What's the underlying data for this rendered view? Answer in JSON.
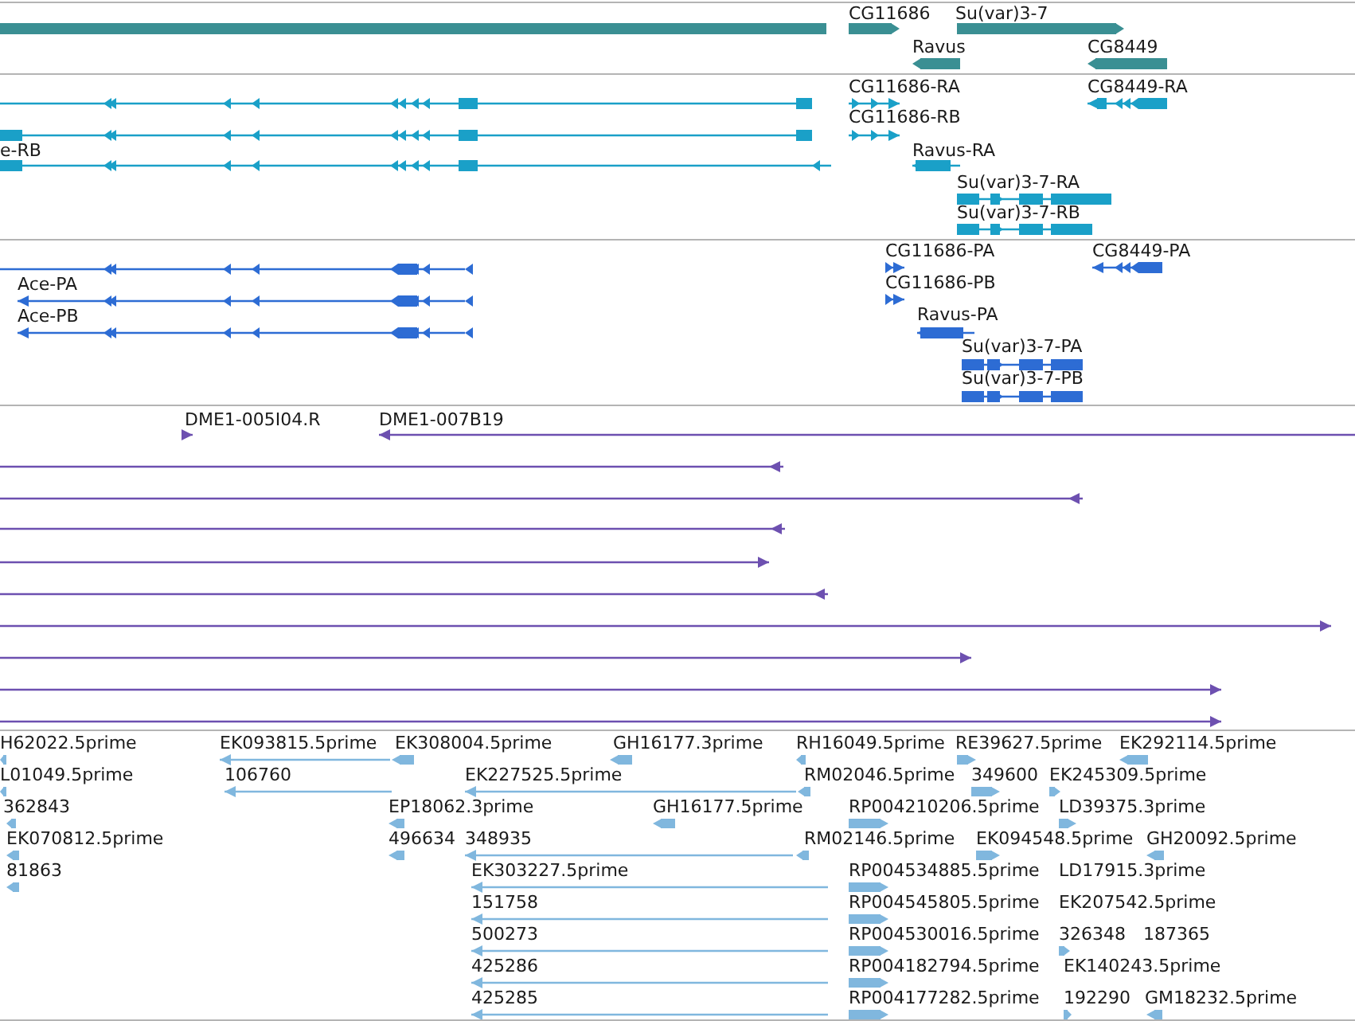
{
  "tracks": [
    {
      "kind": "gene",
      "features": [
        {
          "reverse": true
        },
        {
          "label": "CG11686",
          "reverse": false
        },
        {
          "label": "Su(var)3-7",
          "reverse": false
        },
        {
          "label": "Ravus",
          "reverse": true
        },
        {
          "label": "CG8449",
          "reverse": true
        }
      ]
    },
    {
      "kind": "transcript",
      "features": [
        {
          "reverse": true
        },
        {
          "reverse": true
        },
        {
          "label": "e-RB",
          "reverse": true
        },
        {
          "label": "CG11686-RA",
          "reverse": false
        },
        {
          "label": "CG11686-RB",
          "reverse": false
        },
        {
          "label": "CG8449-RA",
          "reverse": true
        },
        {
          "label": "Ravus-RA",
          "reverse": true
        },
        {
          "label": "Su(var)3-7-RA",
          "reverse": false
        },
        {
          "label": "Su(var)3-7-RB",
          "reverse": false
        }
      ]
    },
    {
      "kind": "protein",
      "features": [
        {
          "reverse": true
        },
        {
          "label": "Ace-PA",
          "reverse": true
        },
        {
          "label": "Ace-PB",
          "reverse": true
        },
        {
          "label": "CG11686-PA",
          "reverse": false
        },
        {
          "label": "CG8449-PA",
          "reverse": true
        },
        {
          "label": "CG11686-PB",
          "reverse": false
        },
        {
          "label": "Ravus-PA",
          "reverse": true
        },
        {
          "label": "Su(var)3-7-PA",
          "reverse": false
        },
        {
          "label": "Su(var)3-7-PB",
          "reverse": false
        }
      ]
    },
    {
      "kind": "clone",
      "features": [
        {
          "label": "DME1-005I04.R",
          "reverse": false
        },
        {
          "label": "DME1-007B19",
          "reverse": true
        },
        {
          "reverse": true
        },
        {
          "reverse": true
        },
        {
          "reverse": true
        },
        {
          "reverse": false
        },
        {
          "reverse": true
        },
        {
          "reverse": false
        },
        {
          "reverse": false
        },
        {
          "reverse": false
        },
        {
          "reverse": false
        }
      ]
    },
    {
      "kind": "est",
      "features": [
        {
          "label": "H62022.5prime",
          "reverse": true
        },
        {
          "label": "EK093815.5prime",
          "reverse": true
        },
        {
          "label": "EK308004.5prime",
          "reverse": true
        },
        {
          "label": "GH16177.3prime",
          "reverse": true
        },
        {
          "label": "RH16049.5prime",
          "reverse": true
        },
        {
          "label": "RE39627.5prime",
          "reverse": false
        },
        {
          "label": "EK292114.5prime",
          "reverse": true
        },
        {
          "label": "L01049.5prime",
          "reverse": true
        },
        {
          "label": "106760",
          "reverse": true
        },
        {
          "label": "EK227525.5prime",
          "reverse": true
        },
        {
          "label": "RM02046.5prime",
          "reverse": true
        },
        {
          "label": "349600",
          "reverse": false
        },
        {
          "label": "EK245309.5prime",
          "reverse": false
        },
        {
          "label": "362843",
          "reverse": true
        },
        {
          "label": "EP18062.3prime",
          "reverse": true
        },
        {
          "label": "GH16177.5prime",
          "reverse": true
        },
        {
          "label": "RP004210206.5prime",
          "reverse": false
        },
        {
          "label": "LD39375.3prime",
          "reverse": false
        },
        {
          "label": "EK070812.5prime",
          "reverse": true
        },
        {
          "label": "496634",
          "reverse": true
        },
        {
          "label": "348935",
          "reverse": true
        },
        {
          "label": "RM02146.5prime",
          "reverse": true
        },
        {
          "label": "EK094548.5prime",
          "reverse": false
        },
        {
          "label": "GH20092.5prime",
          "reverse": true
        },
        {
          "label": "81863",
          "reverse": true
        },
        {
          "label": "EK303227.5prime",
          "reverse": true
        },
        {
          "label": "RP004534885.5prime",
          "reverse": false
        },
        {
          "label": "LD17915.3prime"
        },
        {
          "label": "151758",
          "reverse": true
        },
        {
          "label": "RP004545805.5prime",
          "reverse": false
        },
        {
          "label": "EK207542.5prime"
        },
        {
          "label": "500273",
          "reverse": true
        },
        {
          "label": "RP004530016.5prime",
          "reverse": false
        },
        {
          "label": "326348",
          "reverse": false
        },
        {
          "label": "187365"
        },
        {
          "label": "425286",
          "reverse": true
        },
        {
          "label": "RP004182794.5prime",
          "reverse": false
        },
        {
          "label": "EK140243.5prime"
        },
        {
          "label": "425285",
          "reverse": true
        },
        {
          "label": "RP004177282.5prime",
          "reverse": false
        },
        {
          "label": "192290",
          "reverse": false
        },
        {
          "label": "GM18232.5prime",
          "reverse": true
        }
      ]
    }
  ]
}
